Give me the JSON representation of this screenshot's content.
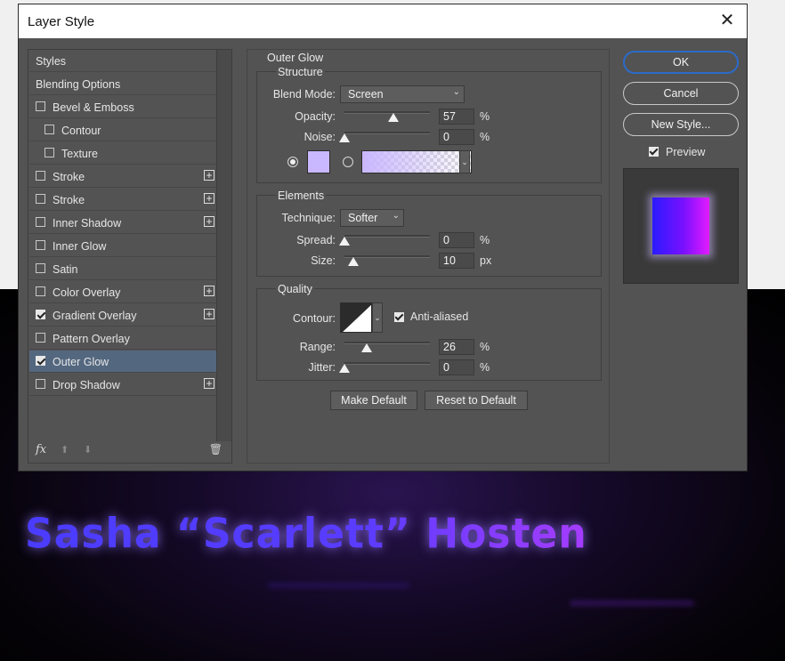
{
  "dialog": {
    "title": "Layer Style",
    "close_icon": "close-icon"
  },
  "styles_list": {
    "items": [
      {
        "label": "Styles",
        "checkbox": false,
        "checked": false,
        "plus": false,
        "selected": false
      },
      {
        "label": "Blending Options",
        "checkbox": false,
        "checked": false,
        "plus": false,
        "selected": false
      },
      {
        "label": "Bevel & Emboss",
        "checkbox": true,
        "checked": false,
        "plus": false,
        "selected": false
      },
      {
        "label": "Contour",
        "checkbox": true,
        "checked": false,
        "plus": false,
        "selected": false,
        "indent": true
      },
      {
        "label": "Texture",
        "checkbox": true,
        "checked": false,
        "plus": false,
        "selected": false,
        "indent": true
      },
      {
        "label": "Stroke",
        "checkbox": true,
        "checked": false,
        "plus": true,
        "selected": false
      },
      {
        "label": "Stroke",
        "checkbox": true,
        "checked": false,
        "plus": true,
        "selected": false
      },
      {
        "label": "Inner Shadow",
        "checkbox": true,
        "checked": false,
        "plus": true,
        "selected": false
      },
      {
        "label": "Inner Glow",
        "checkbox": true,
        "checked": false,
        "plus": false,
        "selected": false
      },
      {
        "label": "Satin",
        "checkbox": true,
        "checked": false,
        "plus": false,
        "selected": false
      },
      {
        "label": "Color Overlay",
        "checkbox": true,
        "checked": false,
        "plus": true,
        "selected": false
      },
      {
        "label": "Gradient Overlay",
        "checkbox": true,
        "checked": true,
        "plus": true,
        "selected": false
      },
      {
        "label": "Pattern Overlay",
        "checkbox": true,
        "checked": false,
        "plus": false,
        "selected": false
      },
      {
        "label": "Outer Glow",
        "checkbox": true,
        "checked": true,
        "plus": false,
        "selected": true
      },
      {
        "label": "Drop Shadow",
        "checkbox": true,
        "checked": false,
        "plus": true,
        "selected": false
      }
    ],
    "footer": {
      "fx_label": "fx",
      "up_icon": "arrow-up-icon",
      "down_icon": "arrow-down-icon",
      "trash_icon": "trash-icon"
    }
  },
  "outer_glow": {
    "title": "Outer Glow",
    "structure": {
      "title": "Structure",
      "blend_mode_label": "Blend Mode:",
      "blend_mode_value": "Screen",
      "opacity_label": "Opacity:",
      "opacity_value": "57",
      "opacity_unit": "%",
      "noise_label": "Noise:",
      "noise_value": "0",
      "noise_unit": "%",
      "glow_color": "#c9b7ff",
      "color_mode": "solid"
    },
    "elements": {
      "title": "Elements",
      "technique_label": "Technique:",
      "technique_value": "Softer",
      "spread_label": "Spread:",
      "spread_value": "0",
      "spread_unit": "%",
      "size_label": "Size:",
      "size_value": "10",
      "size_unit": "px"
    },
    "quality": {
      "title": "Quality",
      "contour_label": "Contour:",
      "anti_aliased_label": "Anti-aliased",
      "anti_aliased": true,
      "range_label": "Range:",
      "range_value": "26",
      "range_unit": "%",
      "jitter_label": "Jitter:",
      "jitter_value": "0",
      "jitter_unit": "%"
    },
    "make_default_label": "Make Default",
    "reset_default_label": "Reset to Default"
  },
  "right_panel": {
    "ok_label": "OK",
    "cancel_label": "Cancel",
    "new_style_label": "New Style...",
    "preview_label": "Preview",
    "preview_checked": true
  },
  "canvas": {
    "banner_text": "Sasha “Scarlett” Hosten",
    "accent_start": "#4a3cff",
    "accent_end": "#c63cff"
  }
}
